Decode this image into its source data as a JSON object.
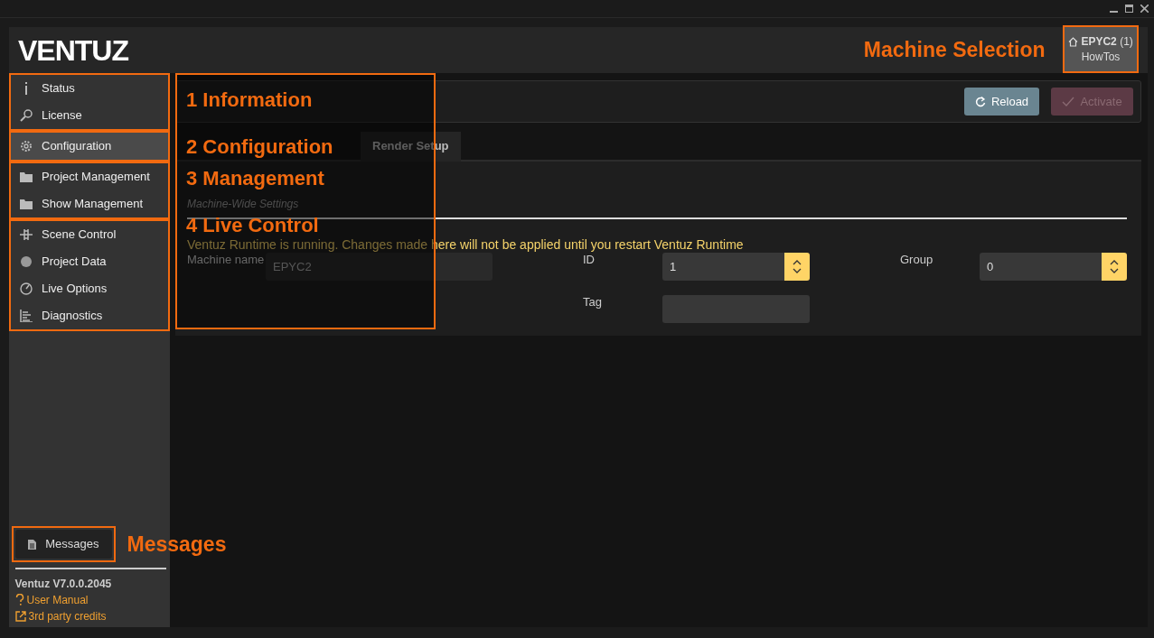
{
  "logo": "VENTUZ",
  "machine": {
    "name": "EPYC2",
    "count": "(1)",
    "project": "HowTos"
  },
  "sidebar": {
    "groups": [
      {
        "items": [
          {
            "label": "Status",
            "selected": false
          },
          {
            "label": "License",
            "selected": false
          }
        ]
      },
      {
        "items": [
          {
            "label": "Configuration",
            "selected": true
          }
        ]
      },
      {
        "items": [
          {
            "label": "Project Management",
            "selected": false
          },
          {
            "label": "Show Management",
            "selected": false
          }
        ]
      },
      {
        "items": [
          {
            "label": "Scene Control",
            "selected": false
          },
          {
            "label": "Project Data",
            "selected": false
          },
          {
            "label": "Live Options",
            "selected": false
          },
          {
            "label": "Diagnostics",
            "selected": false
          }
        ]
      }
    ]
  },
  "messages_button": "Messages",
  "version": "Ventuz V7.0.0.2045",
  "links": [
    "User Manual",
    "3rd party credits"
  ],
  "page": {
    "buttons": [
      {
        "label": "Reload",
        "disabled": false
      },
      {
        "label": "Activate",
        "disabled": true
      }
    ]
  },
  "tabs": [
    {
      "label": "Render Setup",
      "selected": false
    }
  ],
  "section": {
    "subtitle": "Machine-Wide Settings",
    "warning": "Ventuz Runtime is running. Changes made here will not be applied until you restart Ventuz Runtime"
  },
  "fields": [
    {
      "label": "Machine name",
      "value": "EPYC2",
      "kind": "text",
      "disabled": true
    },
    {
      "label": "ID",
      "value": "1",
      "kind": "spinner",
      "disabled": false
    },
    {
      "label": "Group",
      "value": "0",
      "kind": "spinner",
      "disabled": false
    },
    {
      "label": "Tag",
      "kind": "text",
      "disabled": false
    }
  ],
  "annotations": {
    "groups": [
      "1 Information",
      "2 Configuration",
      "3 Management",
      "4 Live Control"
    ],
    "machine": "Machine Selection",
    "messages": "Messages"
  }
}
